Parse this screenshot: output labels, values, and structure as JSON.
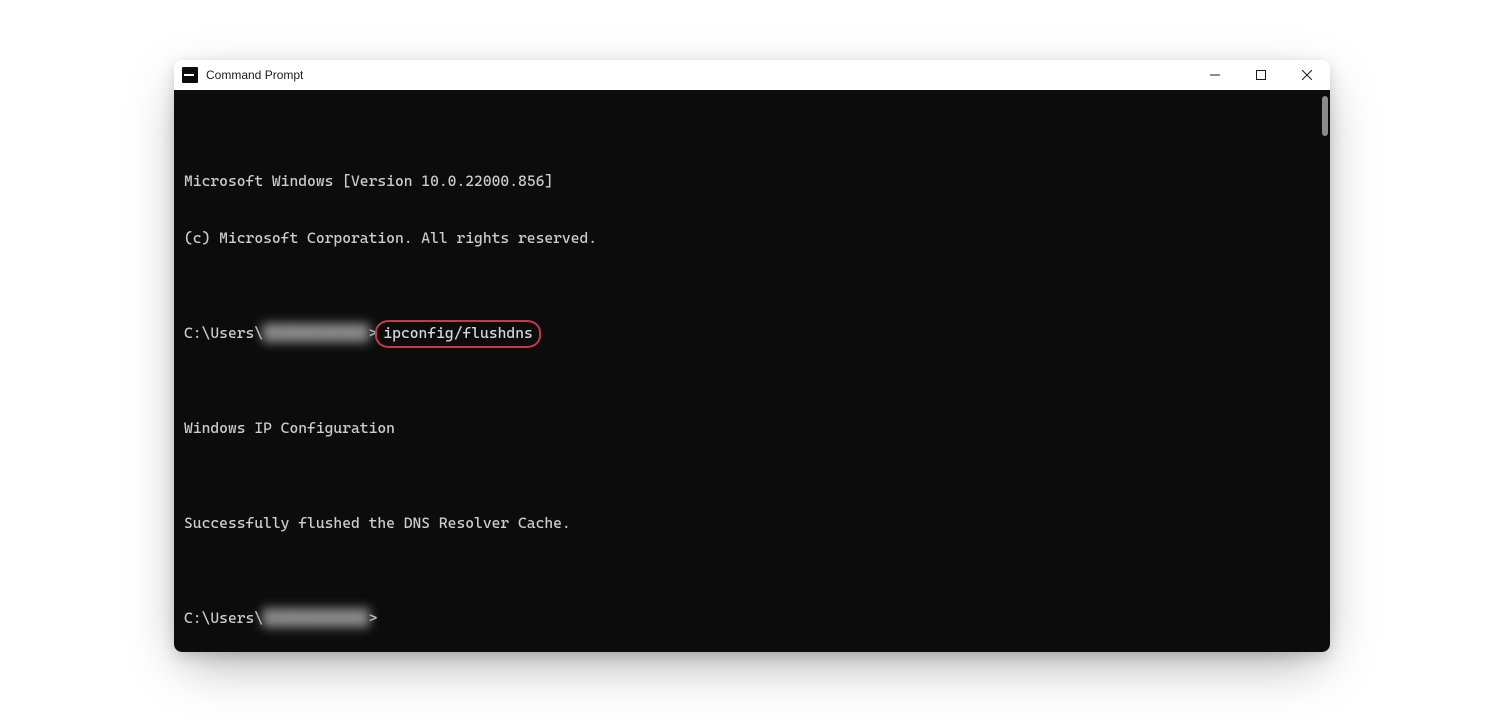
{
  "window": {
    "title": "Command Prompt"
  },
  "terminal": {
    "line1": "Microsoft Windows [Version 10.0.22000.856]",
    "line2": "(c) Microsoft Corporation. All rights reserved.",
    "prompt1_prefix": "C:\\Users\\",
    "prompt1_user_blurred": "████████████",
    "prompt1_sep": ">",
    "command_highlighted": "ipconfig/flushdns",
    "blank": "",
    "result_header": "Windows IP Configuration",
    "result_msg": "Successfully flushed the DNS Resolver Cache.",
    "prompt2_prefix": "C:\\Users\\",
    "prompt2_user_blurred": "████████████",
    "prompt2_sep": ">"
  },
  "annotation": {
    "highlight_color": "#c53a4b"
  }
}
